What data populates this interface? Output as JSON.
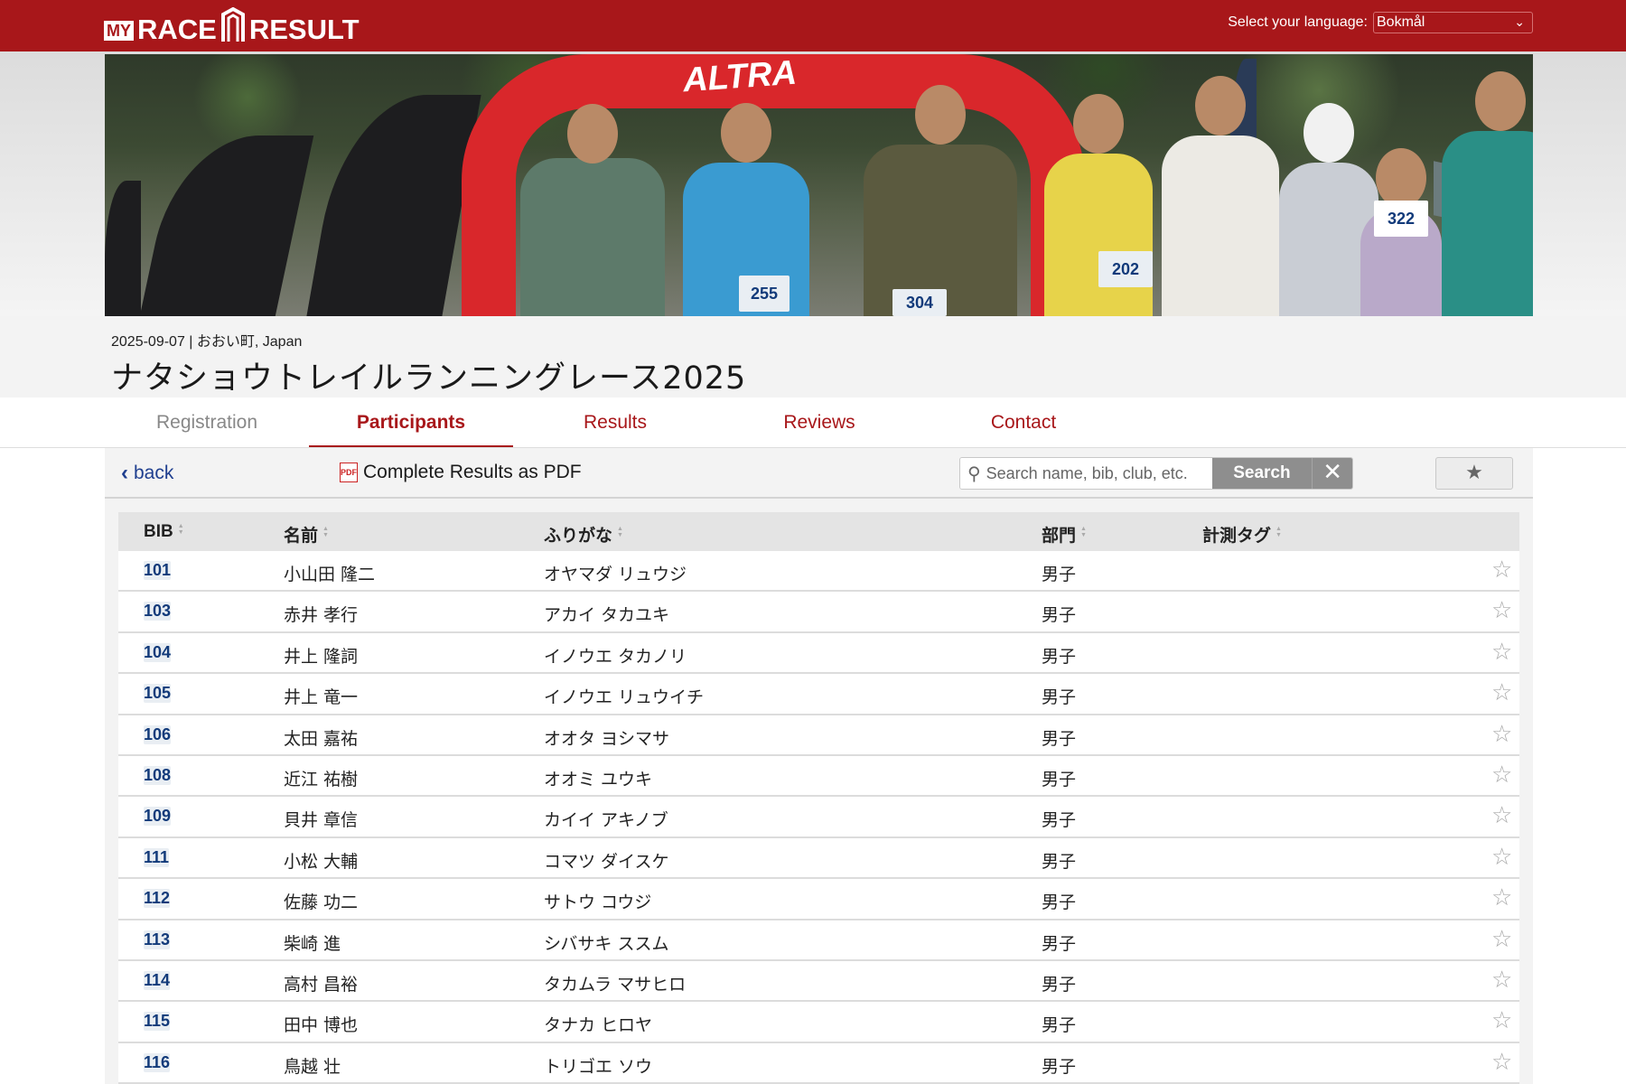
{
  "header": {
    "logo": {
      "my": "MY",
      "race": "RACE",
      "result": "RESULT"
    },
    "language_label": "Select your language:",
    "language_value": "Bokmål"
  },
  "hero": {
    "arch_text": "ALTRA",
    "bibs": [
      "255",
      "304",
      "202",
      "322"
    ]
  },
  "event": {
    "date_location": "2025-09-07 | おおい町, Japan",
    "title": "ナタショウトレイルランニングレース2025"
  },
  "tabs": [
    {
      "label": "Registration",
      "state": "inactive"
    },
    {
      "label": "Participants",
      "state": "active"
    },
    {
      "label": "Results",
      "state": "normal"
    },
    {
      "label": "Reviews",
      "state": "normal"
    },
    {
      "label": "Contact",
      "state": "normal"
    }
  ],
  "toolbar": {
    "back_label": "back",
    "pdf_label": "Complete Results as PDF",
    "search_placeholder": "Search name, bib, club, etc.",
    "search_button": "Search",
    "clear_button": "✕",
    "favorites_button": "★"
  },
  "table": {
    "columns": [
      "BIB",
      "名前",
      "ふりがな",
      "部門",
      "計測タグ"
    ],
    "rows": [
      {
        "bib": "101",
        "name": "小山田 隆二",
        "kana": "オヤマダ リュウジ",
        "division": "男子",
        "tag": ""
      },
      {
        "bib": "103",
        "name": "赤井 孝行",
        "kana": "アカイ タカユキ",
        "division": "男子",
        "tag": ""
      },
      {
        "bib": "104",
        "name": "井上 隆詞",
        "kana": "イノウエ タカノリ",
        "division": "男子",
        "tag": ""
      },
      {
        "bib": "105",
        "name": "井上 竜一",
        "kana": "イノウエ リュウイチ",
        "division": "男子",
        "tag": ""
      },
      {
        "bib": "106",
        "name": "太田 嘉祐",
        "kana": "オオタ ヨシマサ",
        "division": "男子",
        "tag": ""
      },
      {
        "bib": "108",
        "name": "近江 祐樹",
        "kana": "オオミ ユウキ",
        "division": "男子",
        "tag": ""
      },
      {
        "bib": "109",
        "name": "貝井 章信",
        "kana": "カイイ アキノブ",
        "division": "男子",
        "tag": ""
      },
      {
        "bib": "111",
        "name": "小松 大輔",
        "kana": "コマツ ダイスケ",
        "division": "男子",
        "tag": ""
      },
      {
        "bib": "112",
        "name": "佐藤 功二",
        "kana": "サトウ コウジ",
        "division": "男子",
        "tag": ""
      },
      {
        "bib": "113",
        "name": "柴崎 進",
        "kana": "シバサキ ススム",
        "division": "男子",
        "tag": ""
      },
      {
        "bib": "114",
        "name": "高村 昌裕",
        "kana": "タカムラ マサヒロ",
        "division": "男子",
        "tag": ""
      },
      {
        "bib": "115",
        "name": "田中 博也",
        "kana": "タナカ ヒロヤ",
        "division": "男子",
        "tag": ""
      },
      {
        "bib": "116",
        "name": "鳥越 壮",
        "kana": "トリゴエ ソウ",
        "division": "男子",
        "tag": ""
      }
    ]
  },
  "colors": {
    "brand": "#a8171a",
    "link": "#1f3f8f"
  }
}
